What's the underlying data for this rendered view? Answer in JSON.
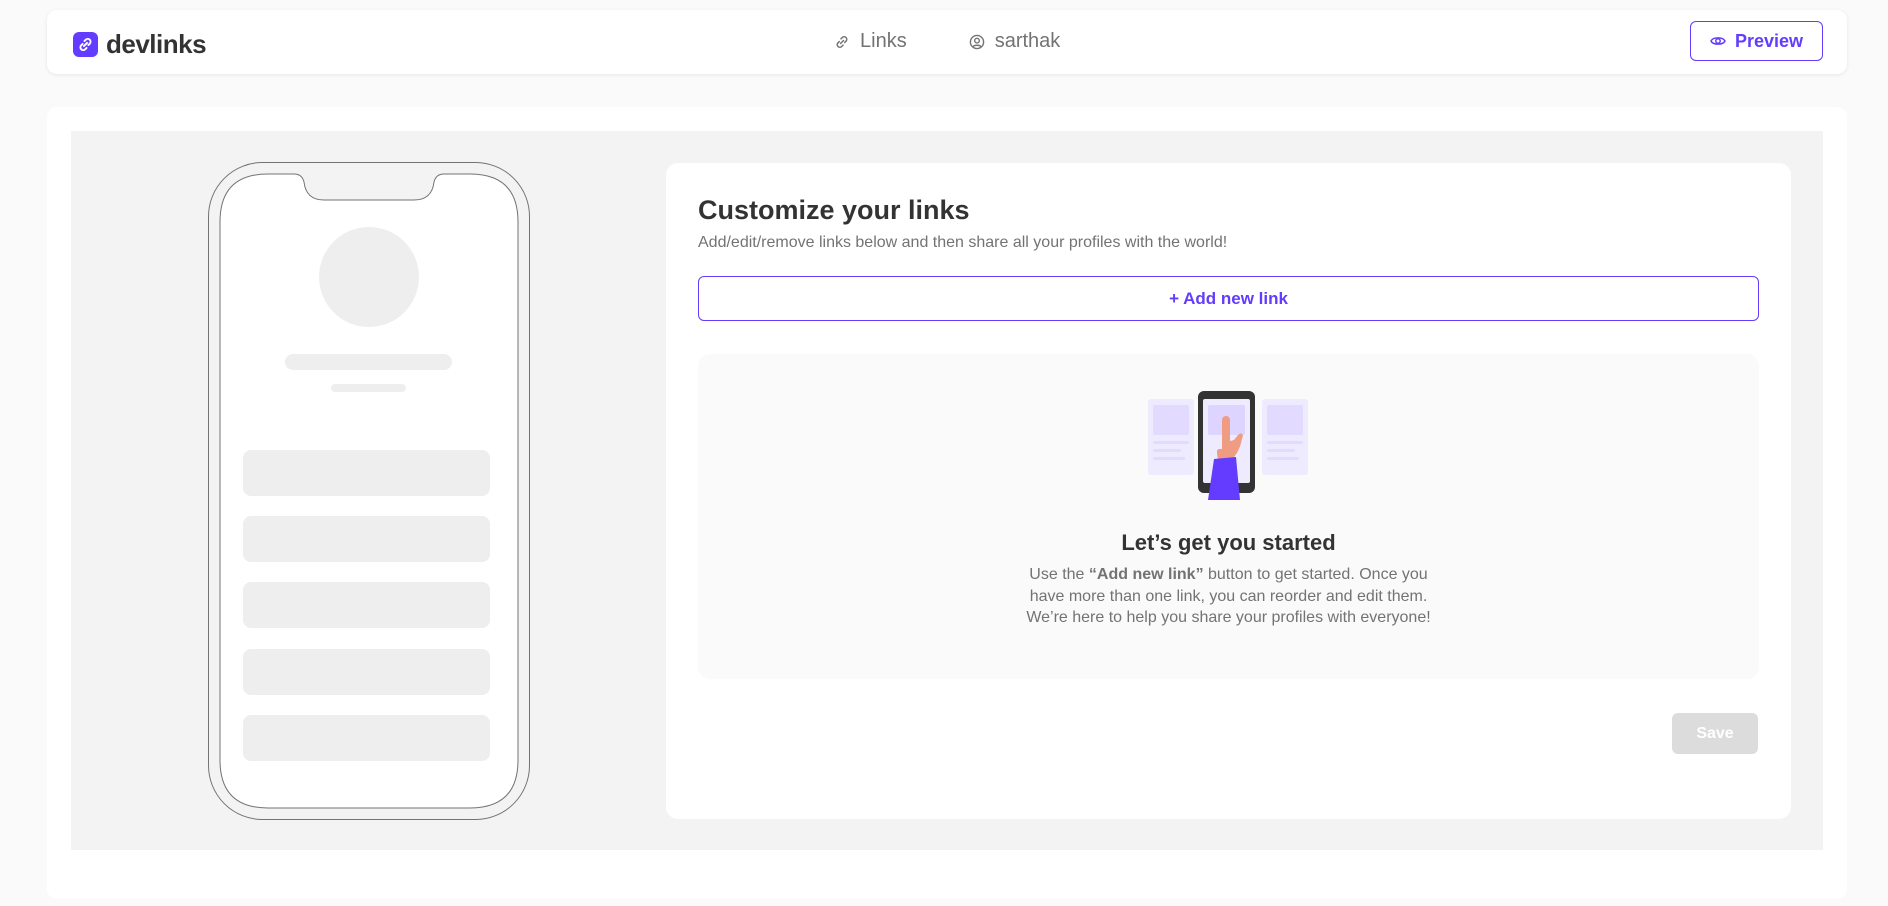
{
  "header": {
    "logo_text": "devlinks",
    "logo_icon": "link-chain-icon",
    "nav": [
      {
        "label": "Links",
        "icon": "link-icon"
      },
      {
        "label": "sarthak",
        "icon": "user-circle-icon"
      }
    ],
    "preview_label": "Preview",
    "preview_icon": "eye-icon"
  },
  "editor": {
    "title": "Customize your links",
    "subtitle": "Add/edit/remove links below and then share all your profiles with the world!",
    "add_link_label": "+ Add new link",
    "empty_state": {
      "title": "Let’s get you started",
      "text_prefix": "Use the ",
      "text_bold": "“Add new link”",
      "text_suffix": " button to get started. Once you have more than one link, you can reorder and edit them. We’re here to help you share your profiles with everyone!",
      "illustration_icon": "hand-tapping-phone-icon"
    },
    "save_label": "Save"
  },
  "colors": {
    "accent": "#633cff",
    "text": "#333333",
    "muted": "#737373",
    "placeholder": "#eeeeee",
    "disabled": "#dcdcdc"
  }
}
